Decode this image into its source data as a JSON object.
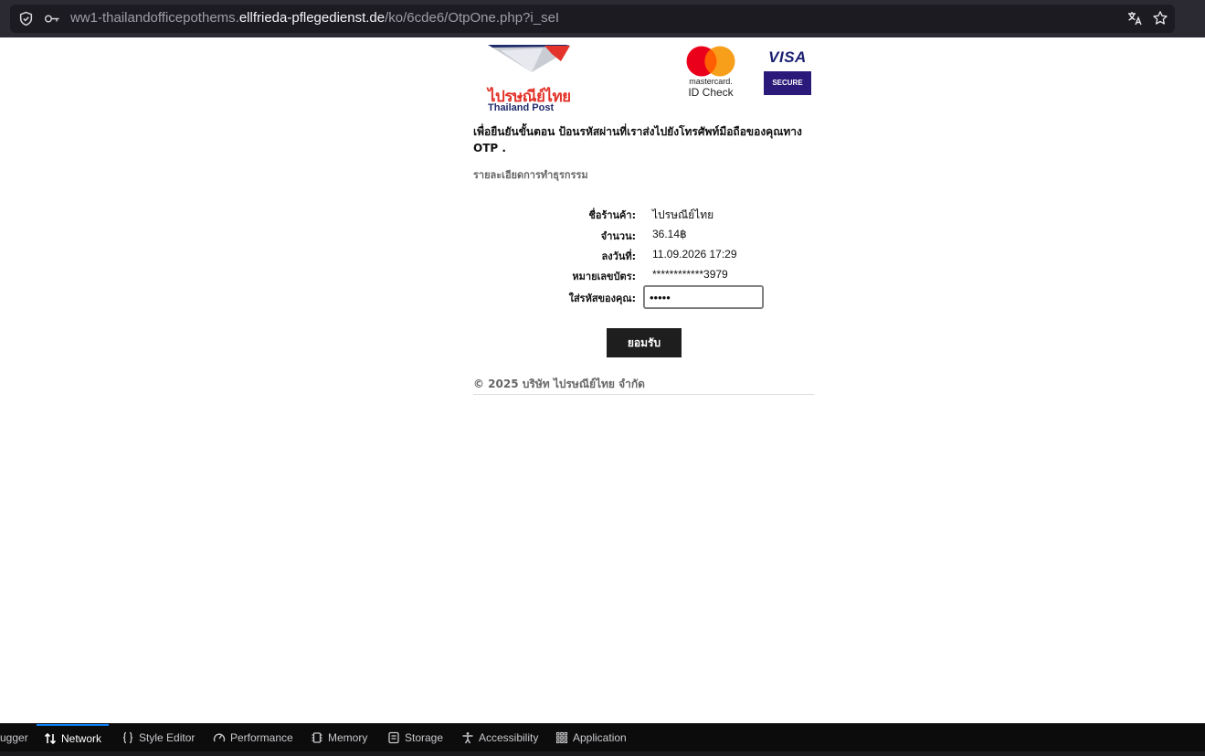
{
  "browser": {
    "url_prefix": "ww1-thailandofficepothems.",
    "url_domain": "ellfrieda-pflegedienst.de",
    "url_path": "/ko/6cde6/OtpOne.php?i_seI"
  },
  "logos": {
    "post_thai": "ไปรษณีย์ไทย",
    "post_en": "Thailand Post",
    "mastercard_word": "mastercard.",
    "mastercard_id": "ID Check",
    "visa_word": "VISA",
    "visa_secure": "SECURE"
  },
  "instruction": "เพื่อยืนยันขั้นตอน ป้อนรหัสผ่านที่เราส่งไปยังโทรศัพท์มือถือของคุณทาง OTP .",
  "details_heading": "รายละเอียดการทำธุรกรรม",
  "transaction": {
    "merchant_label": "ชื่อร้านค้า:",
    "merchant_value": "ไปรษณีย์ไทย",
    "amount_label": "จำนวน:",
    "amount_value": "36.14฿",
    "date_label": "ลงวันที่:",
    "date_value": "11.09.2026 17:29",
    "card_label": "หมายเลขบัตร:",
    "card_value": "************3979",
    "code_label": "ใส่รหัสของคุณ:",
    "code_value": "•••••"
  },
  "submit_label": "ยอมรับ",
  "footer": "© 2025 บริษัท ไปรษณีย์ไทย จำกัด",
  "devtools": {
    "tabs": [
      {
        "label": "ugger"
      },
      {
        "label": "Network",
        "active": true
      },
      {
        "label": "Style Editor"
      },
      {
        "label": "Performance"
      },
      {
        "label": "Memory"
      },
      {
        "label": "Storage"
      },
      {
        "label": "Accessibility"
      },
      {
        "label": "Application"
      }
    ]
  },
  "colors": {
    "post_red": "#e3332a",
    "post_navy": "#1f2b6b",
    "mc_red": "#eb001b",
    "mc_yellow": "#f79e1b",
    "visa_blue": "#1a1f71",
    "devtools_accent": "#0a84ff"
  }
}
